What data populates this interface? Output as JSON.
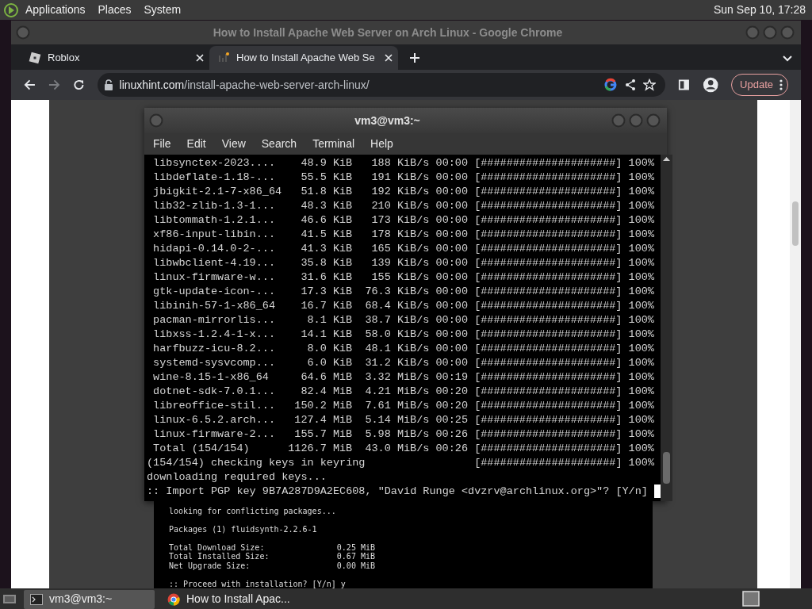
{
  "top_panel": {
    "menus": [
      "Applications",
      "Places",
      "System"
    ],
    "clock": "Sun Sep 10, 17:28"
  },
  "browser": {
    "title": "How to Install Apache Web Server on Arch Linux - Google Chrome",
    "tabs": [
      {
        "label": "Roblox",
        "selected": false
      },
      {
        "label": "How to Install Apache Web Se",
        "selected": true
      }
    ],
    "nav": {
      "back_disabled": false,
      "forward_disabled": true
    },
    "url": {
      "domain": "linuxhint.com",
      "path": "/install-apache-web-server-arch-linux/"
    },
    "update_button": "Update",
    "article_screenshot": [
      {
        "kind": "text",
        "text": "looking for conflicting packages..."
      },
      {
        "kind": "blank"
      },
      {
        "kind": "text",
        "text": "Packages (1) fluidsynth-2.2.6-1"
      },
      {
        "kind": "blank"
      },
      {
        "kind": "pair",
        "label": "Total Download Size:",
        "value": "0.25 MiB"
      },
      {
        "kind": "pair",
        "label": "Total Installed Size:",
        "value": "0.67 MiB"
      },
      {
        "kind": "pair",
        "label": "Net Upgrade Size:",
        "value": "0.00 MiB"
      },
      {
        "kind": "blank"
      },
      {
        "kind": "text",
        "text": ":: Proceed with installation? [Y/n] y"
      }
    ]
  },
  "terminal": {
    "title": "vm3@vm3:~",
    "menus": [
      "File",
      "Edit",
      "View",
      "Search",
      "Terminal",
      "Help"
    ],
    "lines": [
      {
        "kind": "download",
        "name": "libsynctex-2023....",
        "size": "48.9 KiB",
        "rate": "188 KiB/s",
        "time": "00:00",
        "bar": "[#####################]",
        "percent": "100%"
      },
      {
        "kind": "download",
        "name": "libdeflate-1.18-...",
        "size": "55.5 KiB",
        "rate": "191 KiB/s",
        "time": "00:00",
        "bar": "[#####################]",
        "percent": "100%"
      },
      {
        "kind": "download",
        "name": "jbigkit-2.1-7-x86_64",
        "size": "51.8 KiB",
        "rate": "192 KiB/s",
        "time": "00:00",
        "bar": "[#####################]",
        "percent": "100%"
      },
      {
        "kind": "download",
        "name": "lib32-zlib-1.3-1...",
        "size": "48.3 KiB",
        "rate": "210 KiB/s",
        "time": "00:00",
        "bar": "[#####################]",
        "percent": "100%"
      },
      {
        "kind": "download",
        "name": "libtommath-1.2.1...",
        "size": "46.6 KiB",
        "rate": "173 KiB/s",
        "time": "00:00",
        "bar": "[#####################]",
        "percent": "100%"
      },
      {
        "kind": "download",
        "name": "xf86-input-libin...",
        "size": "41.5 KiB",
        "rate": "178 KiB/s",
        "time": "00:00",
        "bar": "[#####################]",
        "percent": "100%"
      },
      {
        "kind": "download",
        "name": "hidapi-0.14.0-2-...",
        "size": "41.3 KiB",
        "rate": "165 KiB/s",
        "time": "00:00",
        "bar": "[#####################]",
        "percent": "100%"
      },
      {
        "kind": "download",
        "name": "libwbclient-4.19...",
        "size": "35.8 KiB",
        "rate": "139 KiB/s",
        "time": "00:00",
        "bar": "[#####################]",
        "percent": "100%"
      },
      {
        "kind": "download",
        "name": "linux-firmware-w...",
        "size": "31.6 KiB",
        "rate": "155 KiB/s",
        "time": "00:00",
        "bar": "[#####################]",
        "percent": "100%"
      },
      {
        "kind": "download",
        "name": "gtk-update-icon-...",
        "size": "17.3 KiB",
        "rate": "76.3 KiB/s",
        "time": "00:00",
        "bar": "[#####################]",
        "percent": "100%"
      },
      {
        "kind": "download",
        "name": "libinih-57-1-x86_64",
        "size": "16.7 KiB",
        "rate": "68.4 KiB/s",
        "time": "00:00",
        "bar": "[#####################]",
        "percent": "100%"
      },
      {
        "kind": "download",
        "name": "pacman-mirrorlis...",
        "size": "8.1 KiB",
        "rate": "38.7 KiB/s",
        "time": "00:00",
        "bar": "[#####################]",
        "percent": "100%"
      },
      {
        "kind": "download",
        "name": "libxss-1.2.4-1-x...",
        "size": "14.1 KiB",
        "rate": "58.0 KiB/s",
        "time": "00:00",
        "bar": "[#####################]",
        "percent": "100%"
      },
      {
        "kind": "download",
        "name": "harfbuzz-icu-8.2...",
        "size": "8.0 KiB",
        "rate": "48.1 KiB/s",
        "time": "00:00",
        "bar": "[#####################]",
        "percent": "100%"
      },
      {
        "kind": "download",
        "name": "systemd-sysvcomp...",
        "size": "6.0 KiB",
        "rate": "31.2 KiB/s",
        "time": "00:00",
        "bar": "[#####################]",
        "percent": "100%"
      },
      {
        "kind": "download",
        "name": "wine-8.15-1-x86_64",
        "size": "64.6 MiB",
        "rate": "3.32 MiB/s",
        "time": "00:19",
        "bar": "[#####################]",
        "percent": "100%"
      },
      {
        "kind": "download",
        "name": "dotnet-sdk-7.0.1...",
        "size": "82.4 MiB",
        "rate": "4.21 MiB/s",
        "time": "00:20",
        "bar": "[#####################]",
        "percent": "100%"
      },
      {
        "kind": "download",
        "name": "libreoffice-stil...",
        "size": "150.2 MiB",
        "rate": "7.61 MiB/s",
        "time": "00:20",
        "bar": "[#####################]",
        "percent": "100%"
      },
      {
        "kind": "download",
        "name": "linux-6.5.2.arch...",
        "size": "127.4 MiB",
        "rate": "5.14 MiB/s",
        "time": "00:25",
        "bar": "[#####################]",
        "percent": "100%"
      },
      {
        "kind": "download",
        "name": "linux-firmware-2...",
        "size": "155.7 MiB",
        "rate": "5.98 MiB/s",
        "time": "00:26",
        "bar": "[#####################]",
        "percent": "100%"
      },
      {
        "kind": "download",
        "name": "Total (154/154)",
        "size": "1126.7 MiB",
        "rate": "43.0 MiB/s",
        "time": "00:26",
        "bar": "[#####################]",
        "percent": "100%"
      },
      {
        "kind": "check",
        "text": "(154/154) checking keys in keyring",
        "bar": "[#####################]",
        "percent": "100%"
      },
      {
        "kind": "text",
        "text": "downloading required keys..."
      },
      {
        "kind": "prompt",
        "text": ":: Import PGP key 9B7A287D9A2EC608, \"David Runge <dvzrv@archlinux.org>\"? [Y/n]"
      }
    ]
  },
  "taskbar": [
    {
      "label": "vm3@vm3:~",
      "kind": "terminal",
      "selected": true
    },
    {
      "label": "How to Install Apac...",
      "kind": "browser",
      "selected": false
    }
  ]
}
